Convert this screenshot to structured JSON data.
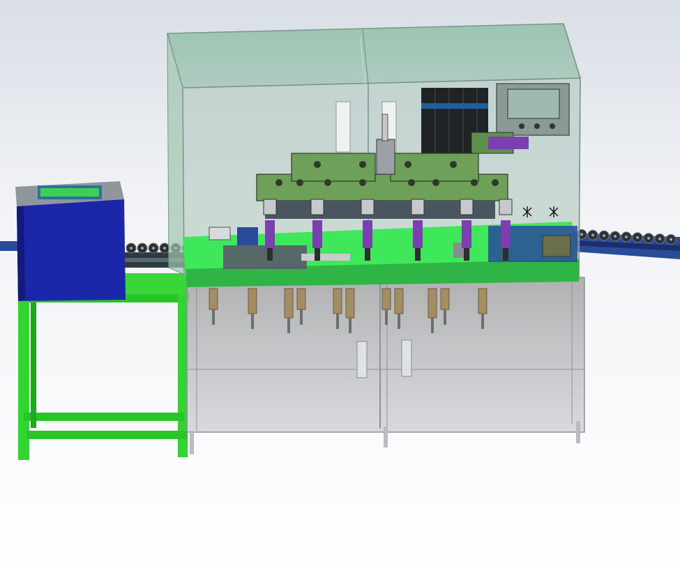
{
  "scene": {
    "colors": {
      "background_top": "#d9dee6",
      "background_bottom": "#ffffff",
      "enclosure_glass": "#7fb59a",
      "enclosure_frame": "#9aa8a0",
      "lower_cabinet": "#a9acad",
      "machine_green": "#6fa05a",
      "deck_green": "#3ee85a",
      "frame_green": "#28c428",
      "control_box_blue": "#1c26a8",
      "conveyor_blue": "#2a4a9a",
      "roller_dark": "#2b3136",
      "panel_black": "#1f2326",
      "cylinder_tan": "#a58d62",
      "purple_parts": "#7b3fb0",
      "hmi_screen": "#9fb8b2"
    }
  }
}
